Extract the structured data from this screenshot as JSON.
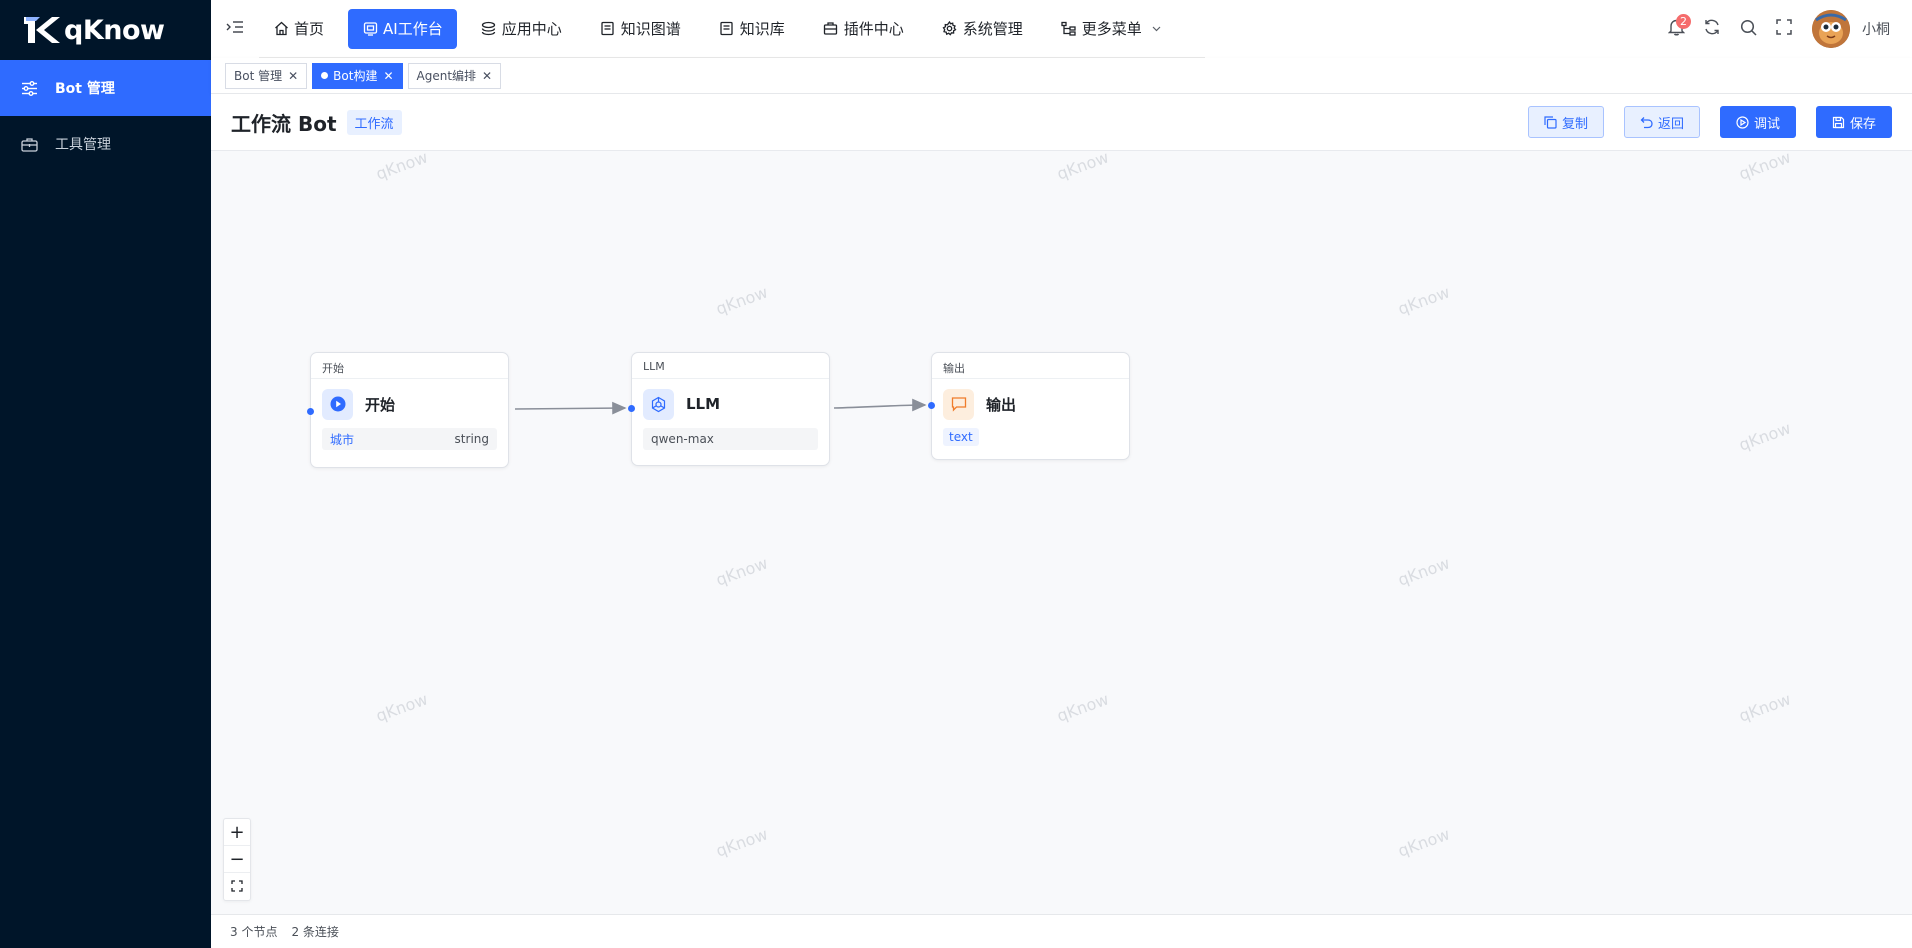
{
  "app": {
    "name": "qKnow"
  },
  "sidebar": {
    "items": [
      {
        "label": "Bot 管理",
        "icon": "sliders-icon",
        "active": true
      },
      {
        "label": "工具管理",
        "icon": "briefcase-icon",
        "active": false
      }
    ]
  },
  "topnav": {
    "menu": [
      {
        "label": "首页",
        "icon": "home-icon",
        "active": false
      },
      {
        "label": "AI工作台",
        "icon": "robot-icon",
        "active": true
      },
      {
        "label": "应用中心",
        "icon": "layers-icon",
        "active": false
      },
      {
        "label": "知识图谱",
        "icon": "book-icon",
        "active": false
      },
      {
        "label": "知识库",
        "icon": "book-icon",
        "active": false
      },
      {
        "label": "插件中心",
        "icon": "briefcase-icon",
        "active": false
      },
      {
        "label": "系统管理",
        "icon": "gear-icon",
        "active": false
      },
      {
        "label": "更多菜单",
        "icon": "tree-icon",
        "active": false
      }
    ],
    "notification_count": "2",
    "username": "小桐"
  },
  "tags": [
    {
      "label": "Bot 管理",
      "active": false
    },
    {
      "label": "Bot构建",
      "active": true
    },
    {
      "label": "Agent编排",
      "active": false
    }
  ],
  "page": {
    "title": "工作流 Bot",
    "type_tag": "工作流",
    "actions": {
      "copy": "复制",
      "back": "返回",
      "debug": "调试",
      "save": "保存"
    }
  },
  "watermark": "qKnow",
  "workflow": {
    "nodes": [
      {
        "header": "开始",
        "name": "开始",
        "var_name": "城市",
        "var_type": "string",
        "icon": "play-icon",
        "color": "#2f6bff"
      },
      {
        "header": "LLM",
        "name": "LLM",
        "model": "qwen-max",
        "icon": "llm-icon",
        "color": "#2f6bff"
      },
      {
        "header": "输出",
        "name": "输出",
        "output_var": "text",
        "icon": "message-icon",
        "color": "#f07c2a"
      }
    ]
  },
  "status": {
    "nodes": "3 个节点",
    "edges": "2 条连接"
  }
}
